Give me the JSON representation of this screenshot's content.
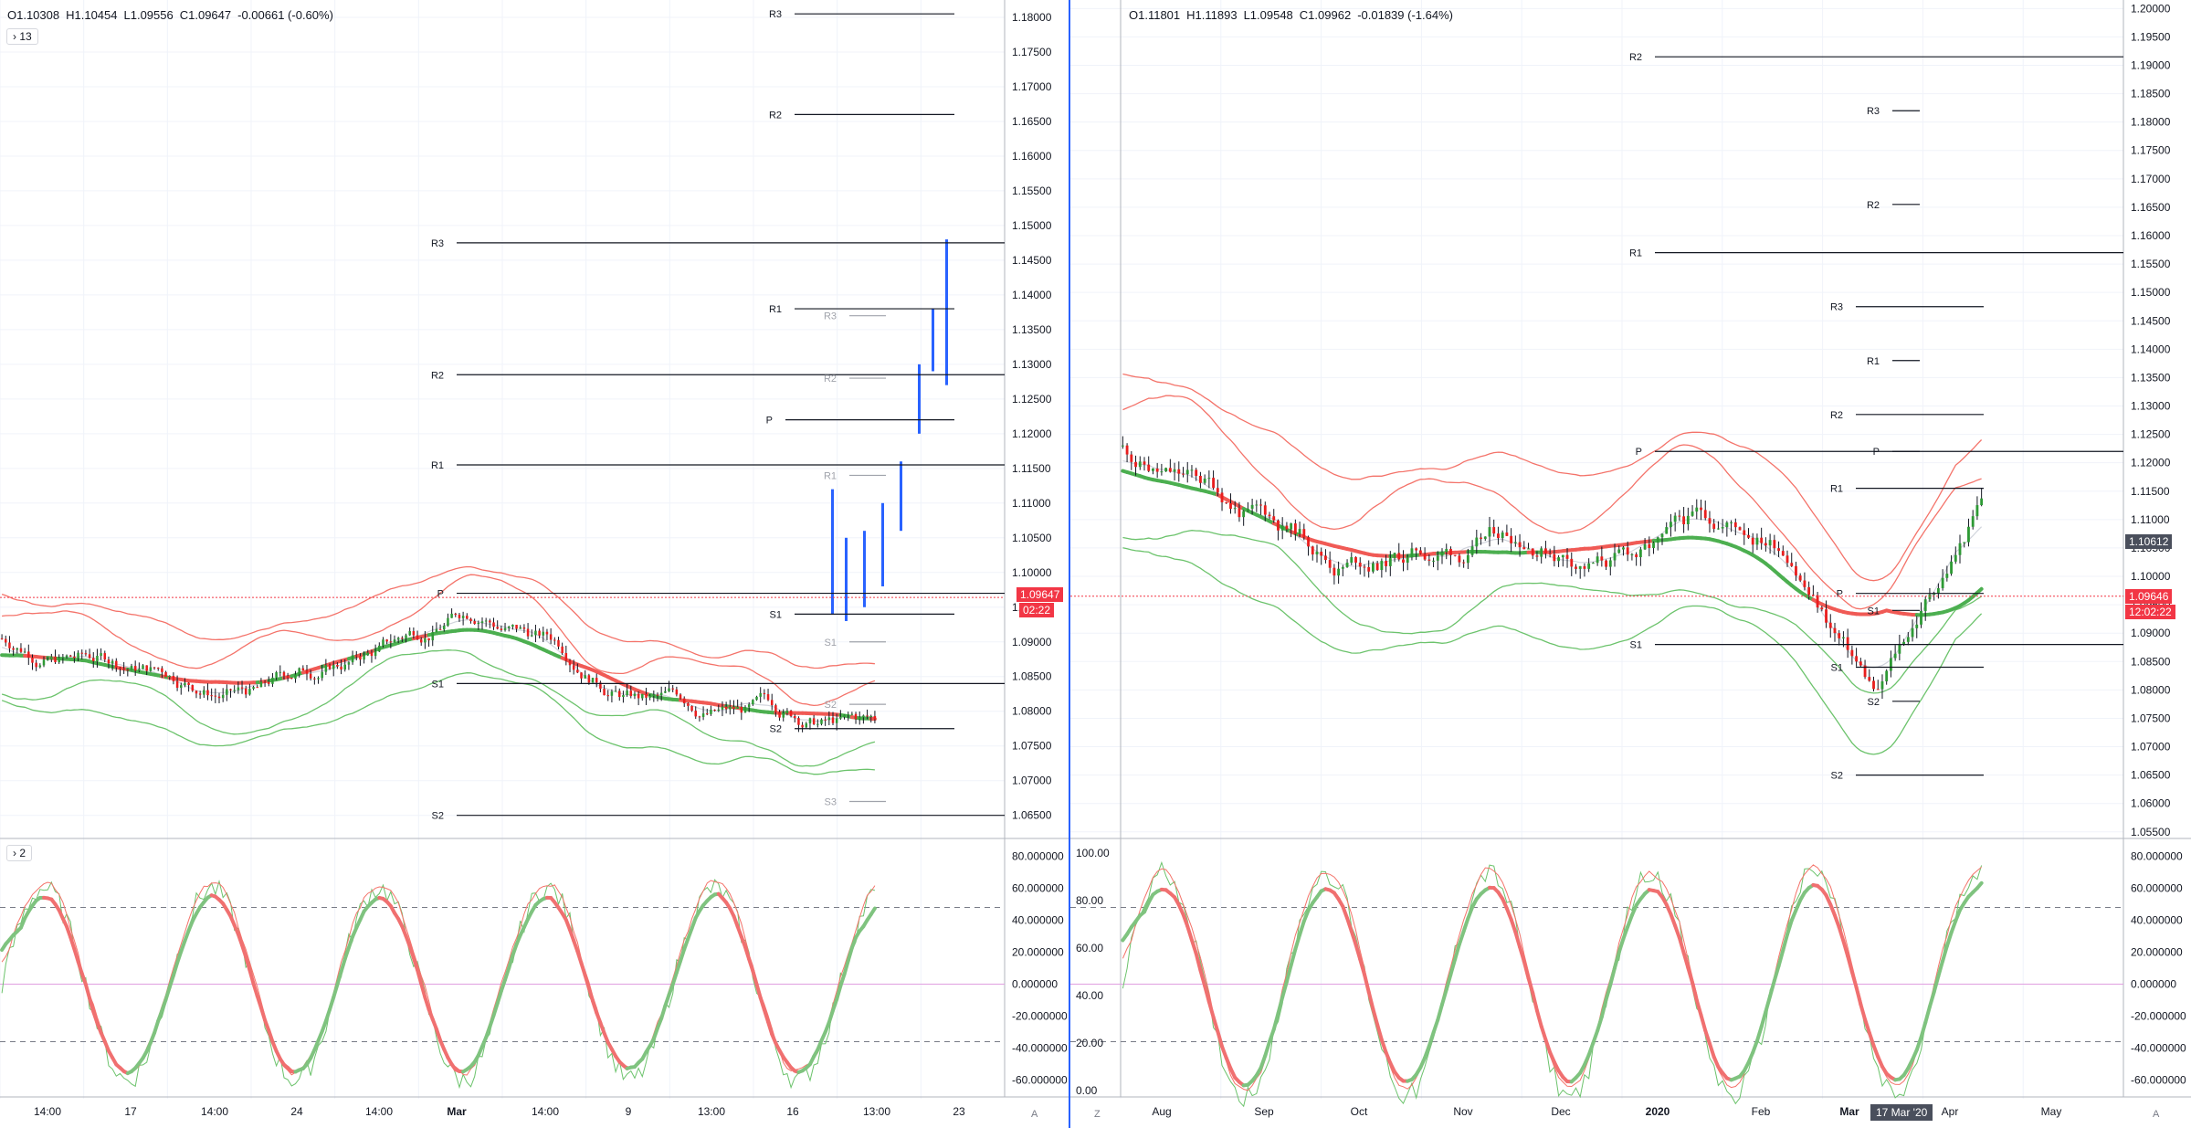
{
  "left": {
    "ohlc": {
      "o": "O1.10308",
      "h": "H1.10454",
      "l": "L1.09556",
      "c": "C1.09647",
      "chg": "-0.00661 (-0.60%)"
    },
    "indicator_toggle": "13",
    "osc_toggle": "2",
    "price_ticks": [
      "1.18000",
      "1.17500",
      "1.17000",
      "1.16500",
      "1.16000",
      "1.15500",
      "1.15000",
      "1.14500",
      "1.14000",
      "1.13500",
      "1.13000",
      "1.12500",
      "1.12000",
      "1.11500",
      "1.11000",
      "1.10500",
      "1.10000",
      "1.09500",
      "1.09000",
      "1.08500",
      "1.08000",
      "1.07500",
      "1.07000",
      "1.06500"
    ],
    "osc_ticks": [
      "80.000000",
      "60.000000",
      "40.000000",
      "20.000000",
      "0.000000",
      "-20.000000",
      "-40.000000",
      "-60.000000"
    ],
    "time_ticks": [
      "14:00",
      "17",
      "14:00",
      "24",
      "14:00",
      "Mar",
      "14:00",
      "9",
      "13:00",
      "16",
      "13:00",
      "23"
    ],
    "last_price": "1.09647",
    "countdown": "02:22",
    "pivot_labels": [
      "R3",
      "R2",
      "R1",
      "P",
      "S1",
      "S2",
      "R3",
      "R2",
      "R1",
      "P",
      "S1",
      "S2",
      "R3",
      "R2",
      "R1",
      "S1",
      "S2",
      "S3"
    ],
    "axis_auto": "A"
  },
  "right": {
    "ohlc": {
      "o": "O1.11801",
      "h": "H1.11893",
      "l": "L1.09548",
      "c": "C1.09962",
      "chg": "-0.01839 (-1.64%)"
    },
    "price_ticks": [
      "1.20000",
      "1.19500",
      "1.19000",
      "1.18500",
      "1.18000",
      "1.17500",
      "1.17000",
      "1.16500",
      "1.16000",
      "1.15500",
      "1.15000",
      "1.14500",
      "1.14000",
      "1.13500",
      "1.13000",
      "1.12500",
      "1.12000",
      "1.11500",
      "1.11000",
      "1.10500",
      "1.10000",
      "1.09500",
      "1.09000",
      "1.08500",
      "1.08000",
      "1.07500",
      "1.07000",
      "1.06500",
      "1.06000",
      "1.05500"
    ],
    "osc_ticks": [
      "80.000000",
      "60.000000",
      "40.000000",
      "20.000000",
      "0.000000",
      "-20.000000",
      "-40.000000",
      "-60.000000"
    ],
    "osc_left_ticks": [
      "100.00",
      "80.00",
      "60.00",
      "40.00",
      "20.00",
      "0.00"
    ],
    "time_ticks": [
      "Aug",
      "Sep",
      "Oct",
      "Nov",
      "Dec",
      "2020",
      "Feb",
      "Mar",
      "Apr",
      "May"
    ],
    "crosshair_price": "1.10612",
    "last_price": "1.09646",
    "countdown": "12:02:22",
    "crosshair_date": "17 Mar '20",
    "pivot_labels": [
      "R2",
      "R3",
      "R2",
      "R1",
      "R3",
      "R1",
      "R2",
      "P",
      "P",
      "R1",
      "P",
      "S1",
      "S1",
      "S1",
      "S2",
      "S2"
    ],
    "axis_auto": "A",
    "axis_z": "Z"
  },
  "colors": {
    "up": "#2e9a35",
    "down": "#e91e1e",
    "band_red": "#f4736a",
    "band_green": "#6cc36c",
    "ma_red": "#f05a55",
    "ma_green": "#4caf50",
    "accent_blue": "#2962ff"
  }
}
